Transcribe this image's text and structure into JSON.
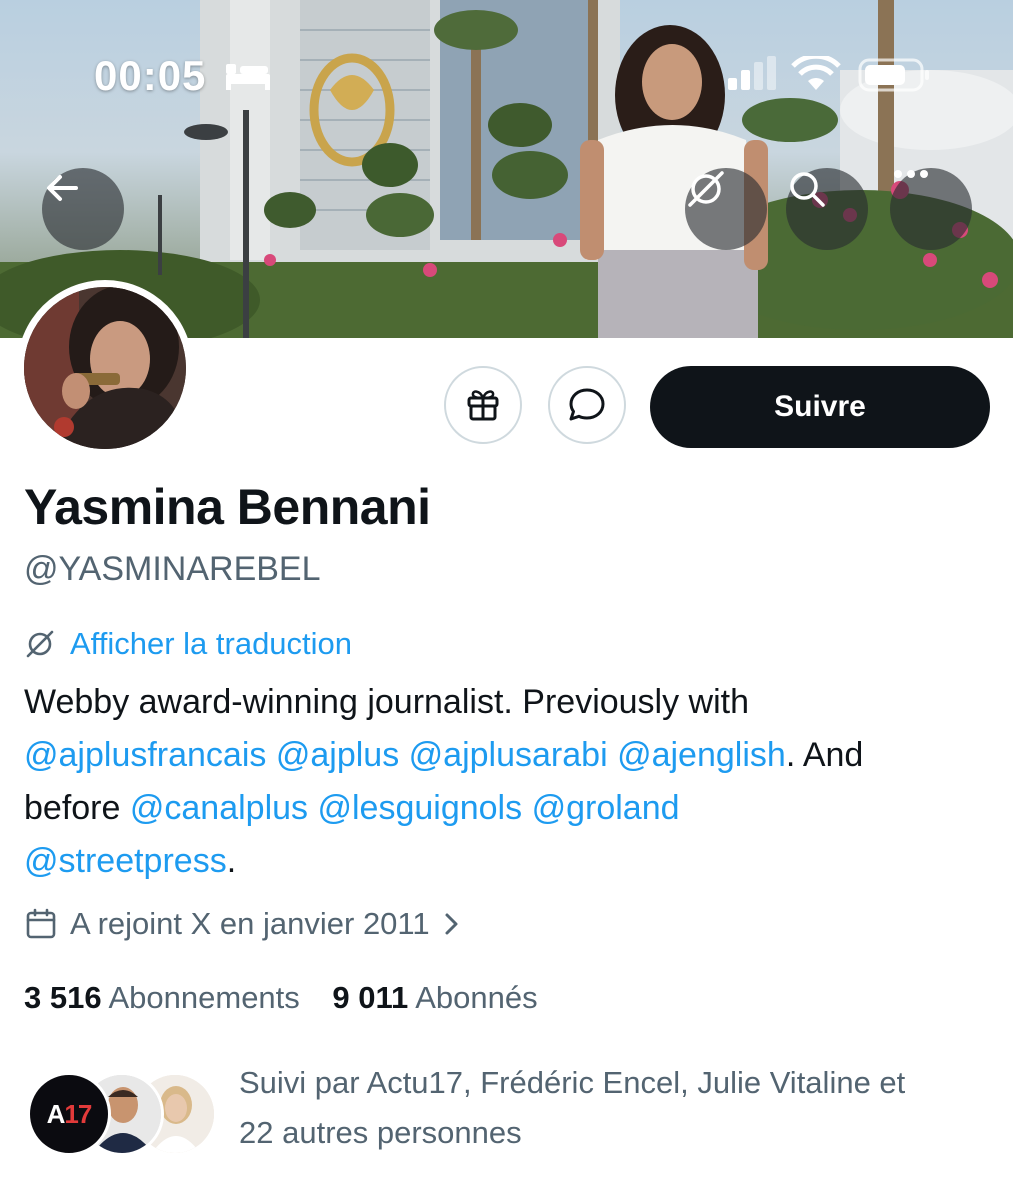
{
  "status_bar": {
    "time": "00:05"
  },
  "profile": {
    "display_name": "Yasmina Bennani",
    "handle": "@YASMINAREBEL",
    "translate_label": "Afficher la traduction",
    "follow_label": "Suivre",
    "bio": {
      "line1": "Webby award-winning journalist. Previously with",
      "mentions_a": [
        "@ajplusfrancais",
        "@ajplus",
        "@ajplusarabi",
        "@ajenglish"
      ],
      "after_a": ". And",
      "before_word": "before",
      "mentions_b": [
        "@canalplus",
        "@lesguignols",
        "@groland"
      ],
      "mention_c": "@streetpress",
      "end": "."
    },
    "joined": "A rejoint X en janvier 2011",
    "following_count": "3 516",
    "following_label": "Abonnements",
    "followers_count": "9 011",
    "followers_label": "Abonnés"
  },
  "followed_by": {
    "text_line1": "Suivi par Actu17, Frédéric Encel, Julie Vitaline et",
    "text_line2": "22 autres personnes",
    "avatars": [
      {
        "name": "Actu17",
        "badge": "A17"
      },
      {
        "name": "Frédéric Encel"
      },
      {
        "name": "Julie Vitaline"
      }
    ]
  },
  "colors": {
    "accent": "#1d9bf0",
    "secondary_text": "#536471",
    "follow_bg": "#0f1419"
  }
}
